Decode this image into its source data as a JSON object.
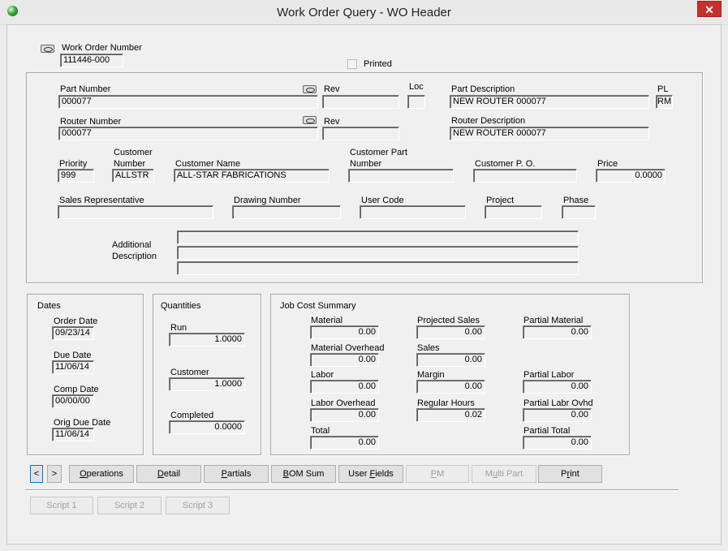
{
  "window": {
    "title": "Work Order Query - WO Header",
    "close": "✕"
  },
  "header": {
    "wo_label": "Work Order Number",
    "wo_value": "111446-000",
    "printed_label": "Printed"
  },
  "part": {
    "part_number_label": "Part Number",
    "part_number": "000077",
    "rev_label": "Rev",
    "rev": "",
    "loc_label": "Loc",
    "loc": "",
    "part_desc_label": "Part Description",
    "part_desc": "NEW ROUTER 000077",
    "pl_label": "PL",
    "pl": "RM",
    "router_number_label": "Router Number",
    "router_number": "000077",
    "router_rev_label": "Rev",
    "router_rev": "",
    "router_desc_label": "Router Description",
    "router_desc": "NEW ROUTER 000077",
    "priority_label": "Priority",
    "priority": "999",
    "customer_number_label1": "Customer",
    "customer_number_label2": "Number",
    "customer_number": "ALLSTR",
    "customer_name_label": "Customer Name",
    "customer_name": "ALL-STAR FABRICATIONS",
    "customer_part_label1": "Customer Part",
    "customer_part_label2": "Number",
    "customer_part": "",
    "customer_po_label": "Customer P. O.",
    "customer_po": "",
    "price_label": "Price",
    "price": "0.0000",
    "sales_rep_label": "Sales Representative",
    "sales_rep": "",
    "drawing_label": "Drawing Number",
    "drawing": "",
    "user_code_label": "User Code",
    "user_code": "",
    "project_label": "Project",
    "project": "",
    "phase_label": "Phase",
    "phase": "",
    "addl_label1": "Additional",
    "addl_label2": "Description",
    "addl_lines": [
      "",
      "",
      ""
    ]
  },
  "dates": {
    "title": "Dates",
    "order_label": "Order Date",
    "order": "09/23/14",
    "due_label": "Due Date",
    "due": "11/06/14",
    "comp_label": "Comp Date",
    "comp": "00/00/00",
    "orig_label": "Orig Due Date",
    "orig": "11/06/14"
  },
  "quantities": {
    "title": "Quantities",
    "run_label": "Run",
    "run": "1.0000",
    "customer_label": "Customer",
    "customer": "1.0000",
    "completed_label": "Completed",
    "completed": "0.0000"
  },
  "jobcost": {
    "title": "Job Cost Summary",
    "material_label": "Material",
    "material": "0.00",
    "mat_oh_label": "Material Overhead",
    "mat_oh": "0.00",
    "labor_label": "Labor",
    "labor": "0.00",
    "labor_oh_label": "Labor Overhead",
    "labor_oh": "0.00",
    "total_label": "Total",
    "total": "0.00",
    "proj_sales_label": "Projected Sales",
    "proj_sales": "0.00",
    "sales_label": "Sales",
    "sales": "0.00",
    "margin_label": "Margin",
    "margin": "0.00",
    "reg_hours_label": "Regular Hours",
    "reg_hours": "0.02",
    "partial_mat_label": "Partial Material",
    "partial_mat": "0.00",
    "partial_labor_label": "Partial Labor",
    "partial_labor": "0.00",
    "partial_labr_ovhd_label": "Partial Labr Ovhd",
    "partial_labr_ovhd": "0.00",
    "partial_total_label": "Partial Total",
    "partial_total": "0.00"
  },
  "buttons": {
    "prev": "<",
    "next": ">",
    "operations_a": "O",
    "operations_b": "perations",
    "detail_a": "D",
    "detail_b": "etail",
    "partials_a": "P",
    "partials_b": "artials",
    "bom_a": "B",
    "bom_b": "OM Sum",
    "user_fields_a": "User ",
    "user_fields_b": "F",
    "user_fields_c": "ields",
    "pm_a": "P",
    "pm_b": "M",
    "multi_a": "M",
    "multi_b": "u",
    "multi_c": "lti Part",
    "print_a": "P",
    "print_b": "r",
    "print_c": "int",
    "script1": "Script 1",
    "script2": "Script 2",
    "script3": "Script 3"
  }
}
